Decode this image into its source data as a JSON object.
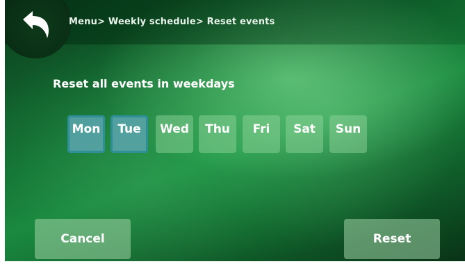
{
  "header": {
    "back_icon": "back-arrow-icon",
    "breadcrumb": "Menu> Weekly schedule> Reset events"
  },
  "main": {
    "heading": "Reset all events in weekdays",
    "days": [
      {
        "label": "Mon",
        "selected": true
      },
      {
        "label": "Tue",
        "selected": true
      },
      {
        "label": "Wed",
        "selected": false
      },
      {
        "label": "Thu",
        "selected": false
      },
      {
        "label": "Fri",
        "selected": false
      },
      {
        "label": "Sat",
        "selected": false
      },
      {
        "label": "Sun",
        "selected": false
      }
    ]
  },
  "footer": {
    "cancel_label": "Cancel",
    "reset_label": "Reset"
  },
  "colors": {
    "background": "#1a8a3f",
    "selected_day": "#5aa5af",
    "selected_border": "#2f8f99",
    "button": "#a0d2a5"
  }
}
